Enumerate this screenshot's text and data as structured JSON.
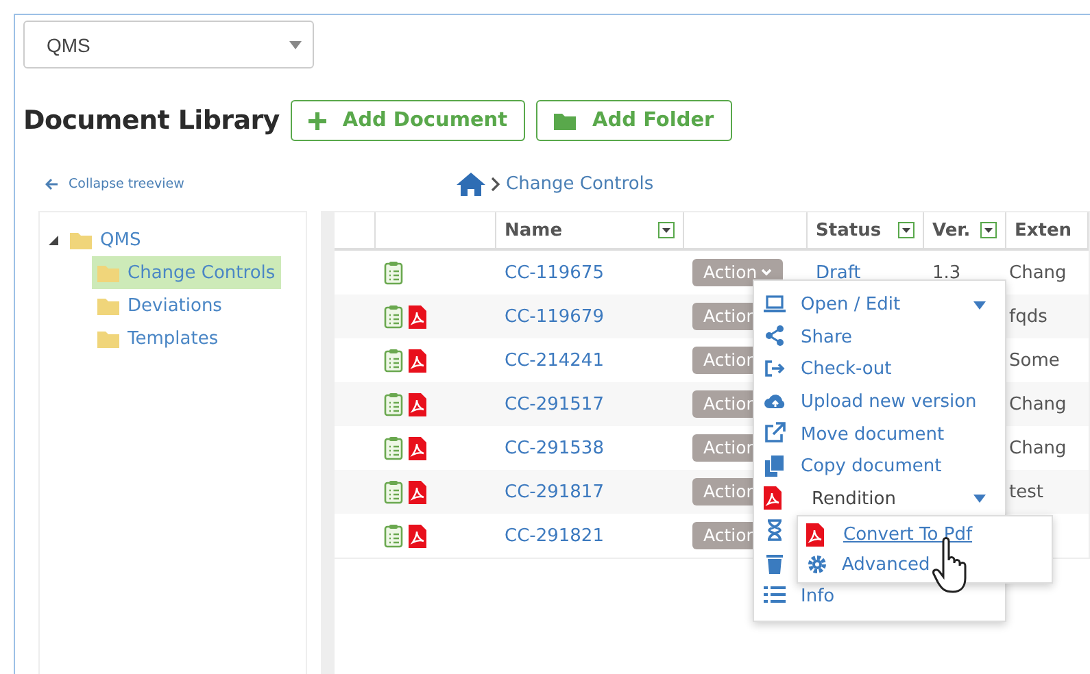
{
  "library_select": {
    "value": "QMS"
  },
  "title": "Document Library",
  "toolbar": [
    {
      "kind": "add",
      "label": "Add Document"
    },
    {
      "kind": "folder",
      "label": "Add Folder"
    }
  ],
  "collapse_link": "Collapse treeview",
  "breadcrumb": {
    "current": "Change Controls"
  },
  "tree": [
    {
      "label": "QMS",
      "expanded": true,
      "selected": false,
      "children": [
        {
          "label": "Change Controls",
          "selected": true
        },
        {
          "label": "Deviations",
          "selected": false
        },
        {
          "label": "Templates",
          "selected": false
        }
      ]
    }
  ],
  "table": {
    "columns": [
      "Name",
      "Status",
      "Ver.",
      "Exten"
    ],
    "rows": [
      {
        "name": "CC-119675",
        "pdf": false,
        "action": "Action",
        "open": true,
        "status": "Draft",
        "version": "1.3",
        "extension": "Chang"
      },
      {
        "name": "CC-119679",
        "pdf": true,
        "action": "Action",
        "open": false,
        "extension": "fqds"
      },
      {
        "name": "CC-214241",
        "pdf": true,
        "action": "Action",
        "open": false,
        "extension": "Some"
      },
      {
        "name": "CC-291517",
        "pdf": true,
        "action": "Action",
        "open": false,
        "extension": "Chang"
      },
      {
        "name": "CC-291538",
        "pdf": true,
        "action": "Action",
        "open": false,
        "extension": "Chang"
      },
      {
        "name": "CC-291817",
        "pdf": true,
        "action": "Action",
        "open": false,
        "extension": "test"
      },
      {
        "name": "CC-291821",
        "pdf": true,
        "action": "Action",
        "open": false
      }
    ]
  },
  "action_menu": [
    {
      "label": "Open / Edit",
      "caret": true
    },
    {
      "label": "Share",
      "caret": false
    },
    {
      "label": "Check-out",
      "caret": false
    },
    {
      "label": "Upload new version",
      "caret": false
    },
    {
      "label": "Move document",
      "caret": false
    },
    {
      "label": "Copy document",
      "caret": false
    },
    {
      "label": "Rendition",
      "caret": true
    },
    {
      "kind": "covered"
    },
    {
      "kind": "covered"
    },
    {
      "label": "Info",
      "caret": false
    }
  ],
  "rendition_submenu": [
    {
      "label": "Convert To Pdf",
      "hovered": true
    },
    {
      "label": "Advanced",
      "hovered": false
    }
  ]
}
